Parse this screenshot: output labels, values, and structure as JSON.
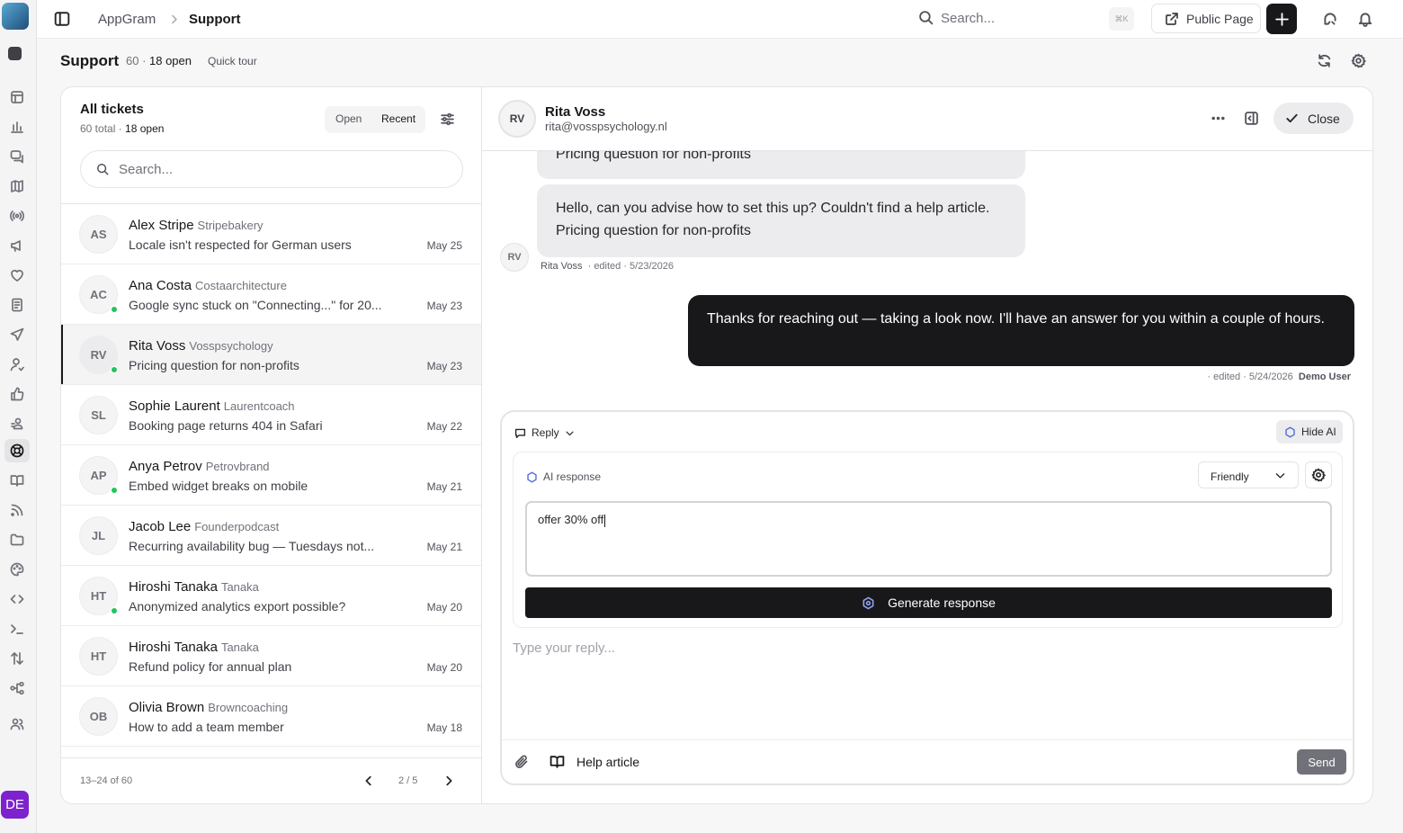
{
  "topbar": {
    "breadcrumb": [
      "AppGram",
      "Support"
    ],
    "search_placeholder": "Search...",
    "shortcut": "⌘K",
    "public_page_label": "Public Page"
  },
  "page": {
    "title": "Support",
    "count": "60 ·",
    "open": "18 open",
    "tour_label": "Quick tour"
  },
  "list": {
    "title": "All tickets",
    "total": "60 total ·",
    "open": "18 open",
    "seg_open": "Open",
    "seg_recent": "Recent",
    "search_placeholder": "Search...",
    "tickets": [
      {
        "initials": "AS",
        "name": "Alex Stripe",
        "company": "Stripebakery",
        "subject": "Locale isn't respected for German users",
        "date": "May 25",
        "online": false,
        "selected": false
      },
      {
        "initials": "AC",
        "name": "Ana Costa",
        "company": "Costaarchitecture",
        "subject": "Google sync stuck on \"Connecting...\" for 20...",
        "date": "May 23",
        "online": true,
        "selected": false
      },
      {
        "initials": "RV",
        "name": "Rita Voss",
        "company": "Vosspsychology",
        "subject": "Pricing question for non-profits",
        "date": "May 23",
        "online": true,
        "selected": true
      },
      {
        "initials": "SL",
        "name": "Sophie Laurent",
        "company": "Laurentcoach",
        "subject": "Booking page returns 404 in Safari",
        "date": "May 22",
        "online": false,
        "selected": false
      },
      {
        "initials": "AP",
        "name": "Anya Petrov",
        "company": "Petrovbrand",
        "subject": "Embed widget breaks on mobile",
        "date": "May 21",
        "online": true,
        "selected": false
      },
      {
        "initials": "JL",
        "name": "Jacob Lee",
        "company": "Founderpodcast",
        "subject": "Recurring availability bug — Tuesdays not...",
        "date": "May 21",
        "online": false,
        "selected": false
      },
      {
        "initials": "HT",
        "name": "Hiroshi Tanaka",
        "company": "Tanaka",
        "subject": "Anonymized analytics export possible?",
        "date": "May 20",
        "online": true,
        "selected": false
      },
      {
        "initials": "HT",
        "name": "Hiroshi Tanaka",
        "company": "Tanaka",
        "subject": "Refund policy for annual plan",
        "date": "May 20",
        "online": false,
        "selected": false
      },
      {
        "initials": "OB",
        "name": "Olivia Brown",
        "company": "Browncoaching",
        "subject": "How to add a team member",
        "date": "May 18",
        "online": false,
        "selected": false
      }
    ],
    "range": "13–24 of 60",
    "page": "2 / 5"
  },
  "conversation": {
    "contact_initials": "RV",
    "contact_name": "Rita Voss",
    "contact_email": "rita@vosspsychology.nl",
    "close_label": "Close",
    "msg_partial": "Pricing question for non-profits",
    "msg_text": "Hello, can you advise how to set this up? Couldn't find a help article. Pricing question for non-profits",
    "msg_meta_author": "Rita Voss",
    "msg_meta_rest": "· edited · 5/23/2026",
    "reply_text": "Thanks for reaching out — taking a look now. I'll have an answer for you within a couple of hours.",
    "reply_meta_rest": "· edited · 5/24/2026",
    "reply_meta_author": "Demo User"
  },
  "composer": {
    "mode_label": "Reply",
    "hide_ai_label": "Hide AI",
    "ai_label": "AI response",
    "tone": "Friendly",
    "ai_prompt": "offer 30% off",
    "generate_label": "Generate response",
    "reply_placeholder": "Type your reply...",
    "help_article_label": "Help article",
    "send_label": "Send"
  },
  "user": {
    "initials": "DE"
  },
  "colors": {
    "accent": "#18181b",
    "online": "#22c55e",
    "avatar": "#7e22ce"
  }
}
